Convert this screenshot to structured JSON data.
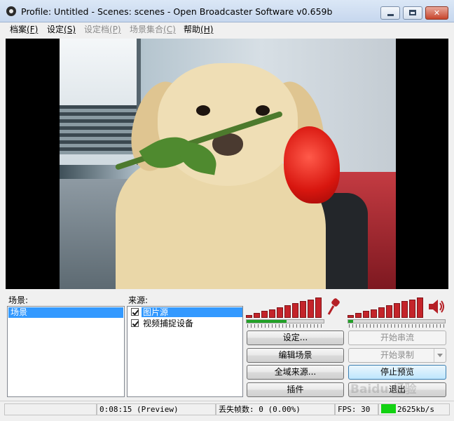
{
  "window": {
    "title": "Profile: Untitled - Scenes: scenes - Open Broadcaster Software v0.659b",
    "minimize_label": "",
    "maximize_label": "",
    "close_label": "✕"
  },
  "menu": {
    "items": [
      {
        "label": "档案",
        "key": "(F)",
        "enabled": true
      },
      {
        "label": "设定",
        "key": "(S)",
        "enabled": true
      },
      {
        "label": "设定档",
        "key": "(P)",
        "enabled": false
      },
      {
        "label": "场景集合",
        "key": "(C)",
        "enabled": false
      },
      {
        "label": "帮助",
        "key": "(H)",
        "enabled": true
      }
    ]
  },
  "scenes": {
    "label": "场景:",
    "items": [
      {
        "name": "场景",
        "selected": true
      }
    ]
  },
  "sources": {
    "label": "来源:",
    "items": [
      {
        "name": "图片源",
        "checked": true,
        "selected": true
      },
      {
        "name": "视频捕捉设备",
        "checked": true,
        "selected": false
      }
    ]
  },
  "audio": {
    "mic_icon": "microphone-icon",
    "speaker_icon": "speaker-icon",
    "meter_color": "#c4242a",
    "level_color": "#21a126"
  },
  "buttons": {
    "settings": "设定...",
    "start_stream": "开始串流",
    "edit_scene": "编辑场景",
    "start_recording": "开始录制",
    "global_sources": "全域来源...",
    "stop_preview": "停止预览",
    "plugins": "插件",
    "exit": "退出"
  },
  "status": {
    "time": "0:08:15 (Preview)",
    "dropped_frames": "丢失帧数: 0 (0.00%)",
    "fps": "FPS: 30",
    "bitrate": "2625kb/s",
    "bitrate_indicator_color": "#12d212"
  },
  "watermark": "Baidu 经验"
}
